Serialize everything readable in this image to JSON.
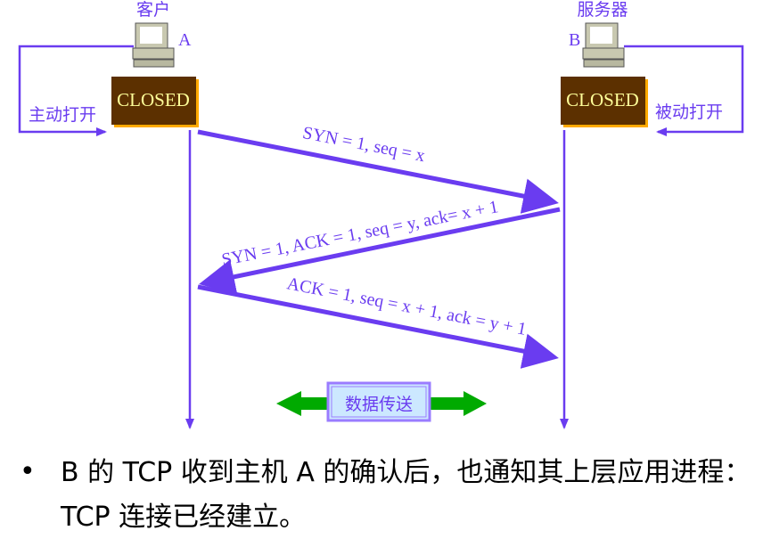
{
  "client": {
    "title": "客户",
    "host": "A",
    "state": "CLOSED",
    "open": "主动打开"
  },
  "server": {
    "title": "服务器",
    "host": "B",
    "state": "CLOSED",
    "open": "被动打开"
  },
  "segments": [
    "SYN = 1, seq = x",
    "SYN = 1, ACK = 1, seq = y, ack= x + 1",
    "ACK = 1, seq = x + 1, ack = y + 1"
  ],
  "data_transfer": "数据传送",
  "bullet": "B 的 TCP 收到主机 A 的确认后，也通知其上层应用进程：TCP 连接已经建立。",
  "colors": {
    "arrow": "#6a3cf0",
    "state_box": "#5c3000",
    "state_text": "#ffff99",
    "data_arrow": "#00aa00",
    "data_box": "#cce8ff"
  }
}
